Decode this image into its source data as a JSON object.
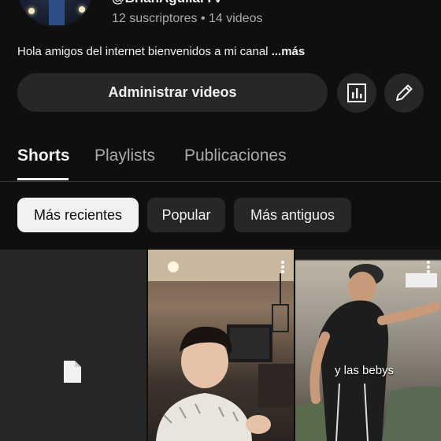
{
  "channel": {
    "handle": "@BrianAguilarTV",
    "stats": "12 suscriptores • 14 videos",
    "description": "Hola amigos del internet bienvenidos a mi canal",
    "more_label": "...más"
  },
  "actions": {
    "manage_label": "Administrar videos",
    "analytics_icon": "bar-chart-icon",
    "edit_icon": "pencil-icon"
  },
  "tabs": [
    {
      "label": "Shorts",
      "active": true
    },
    {
      "label": "Playlists",
      "active": false
    },
    {
      "label": "Publicaciones",
      "active": false
    }
  ],
  "filters": [
    {
      "label": "Más recientes",
      "active": true
    },
    {
      "label": "Popular",
      "active": false
    },
    {
      "label": "Más antiguos",
      "active": false
    }
  ],
  "shorts": [
    {
      "type": "processing",
      "icon": "file-icon"
    },
    {
      "type": "video",
      "caption": ""
    },
    {
      "type": "video",
      "caption": "y las bebys"
    }
  ],
  "colors": {
    "background": "#0f0f0f",
    "button_bg": "#272727",
    "text_primary": "#f1f1f1",
    "text_secondary": "#aaaaaa"
  }
}
